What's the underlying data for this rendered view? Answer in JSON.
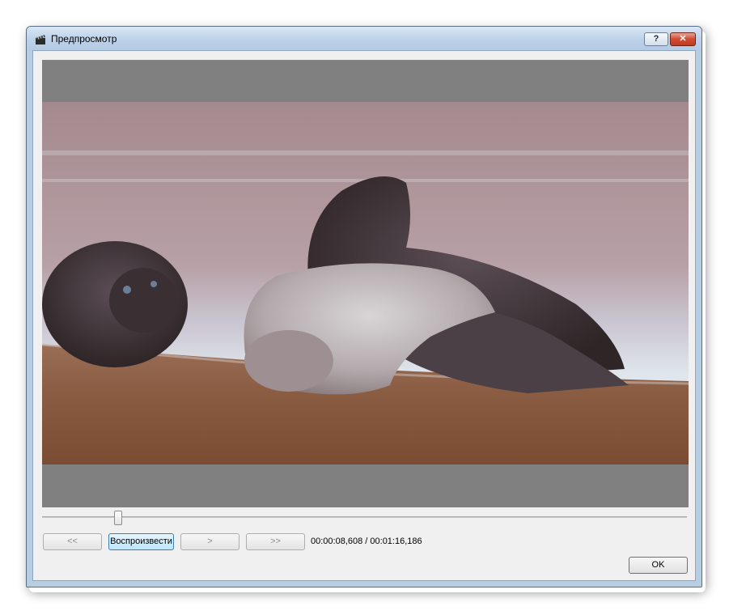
{
  "window": {
    "title": "Предпросмотр",
    "icon": "clapperboard-icon",
    "help_label": "?",
    "close_label": "✕"
  },
  "preview": {
    "image_description_icon": "video-frame"
  },
  "playback": {
    "rewind_label": "<<",
    "play_label": "Воспроизвести",
    "step_label": ">",
    "forward_label": ">>",
    "time": "00:00:08,608 / 00:01:16,186",
    "position_fraction": 0.113
  },
  "footer": {
    "ok_label": "OK"
  },
  "colors": {
    "video_background": "#808080",
    "play_button_accent": "#3c7fb1",
    "close_button": "#c23a22"
  }
}
